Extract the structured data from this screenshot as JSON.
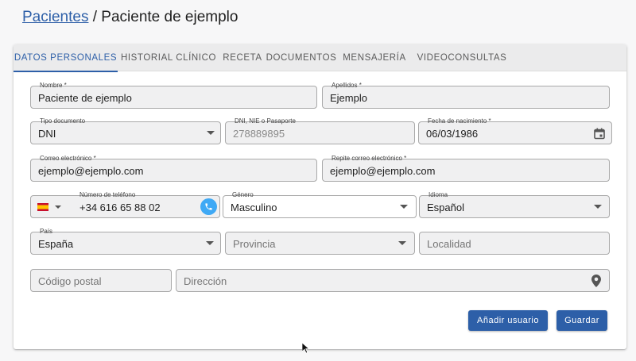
{
  "breadcrumb": {
    "link": "Pacientes",
    "separator": " / ",
    "current": "Paciente de ejemplo"
  },
  "tabs": [
    {
      "label": "DATOS PERSONALES",
      "active": true
    },
    {
      "label": "HISTORIAL CLÍNICO"
    },
    {
      "label": "RECETA"
    },
    {
      "label": "DOCUMENTOS"
    },
    {
      "label": "MENSAJERÍA"
    },
    {
      "label": "VIDEOCONSULTAS"
    }
  ],
  "form": {
    "nombre": {
      "label": "Nombre *",
      "value": "Paciente de ejemplo"
    },
    "apellidos": {
      "label": "Apellidos *",
      "value": "Ejemplo"
    },
    "tipo_documento": {
      "label": "Tipo documento",
      "value": "DNI"
    },
    "documento": {
      "label": "DNI, NIE o Pasaporte",
      "value": "278889895"
    },
    "fecha_nacimiento": {
      "label": "Fecha de nacimiento *",
      "value": "06/03/1986"
    },
    "correo": {
      "label": "Correo electrónico *",
      "value": "ejemplo@ejemplo.com"
    },
    "repite_correo": {
      "label": "Repite correo electrónico *",
      "value": "ejemplo@ejemplo.com"
    },
    "telefono": {
      "label": "Número de teléfono",
      "value": "+34 616 65 88 02"
    },
    "genero": {
      "label": "Género",
      "value": "Masculino"
    },
    "idioma": {
      "label": "Idioma",
      "value": "Español"
    },
    "pais": {
      "label": "País",
      "value": "España"
    },
    "provincia": {
      "placeholder": "Provincia"
    },
    "localidad": {
      "placeholder": "Localidad"
    },
    "codigo_postal": {
      "placeholder": "Código postal"
    },
    "direccion": {
      "placeholder": "Dirección"
    }
  },
  "buttons": {
    "add_user": "Añadir usuario",
    "save": "Guardar"
  },
  "colors": {
    "primary": "#2d5fa8",
    "phone": "#3fa9f5",
    "field_bg": "#f0f0f1"
  },
  "icons": {
    "date": "calendar-icon",
    "phone": "phone-icon",
    "address": "location-pin-icon",
    "flag": "spain-flag-icon"
  }
}
